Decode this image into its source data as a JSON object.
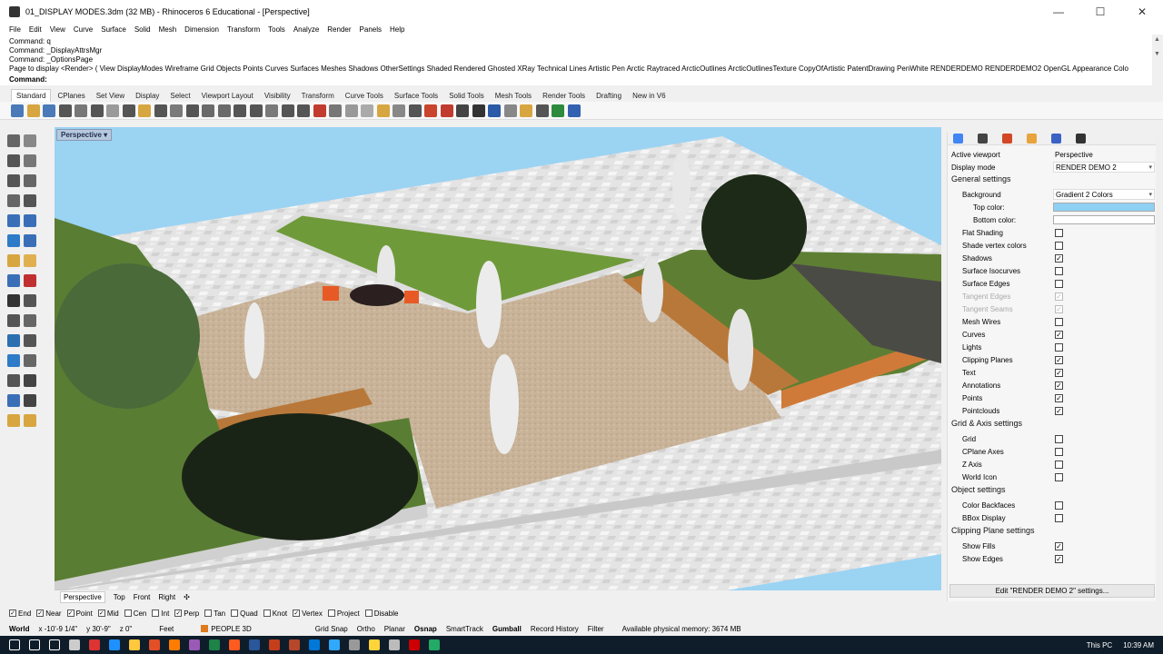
{
  "window": {
    "title": "01_DISPLAY MODES.3dm (32 MB) - Rhinoceros 6 Educational - [Perspective]",
    "minimize": "—",
    "maximize": "☐",
    "close": "✕"
  },
  "menu": [
    "File",
    "Edit",
    "View",
    "Curve",
    "Surface",
    "Solid",
    "Mesh",
    "Dimension",
    "Transform",
    "Tools",
    "Analyze",
    "Render",
    "Panels",
    "Help"
  ],
  "command_history": [
    "Command: q",
    "Command: _DisplayAttrsMgr",
    "Command: _OptionsPage",
    "Page to display <Render> ( View DisplayModes Wireframe Grid Objects Points Curves Surfaces Meshes Shadows OtherSettings Shaded Rendered Ghosted XRay Technical Lines Artistic Pen Arctic Raytraced ArcticOutlines ArcticOutlinesTexture CopyOfArtistic PatentDrawing PenWhite RENDERDEMO RENDERDEMO2 OpenGL Appearance Colo"
  ],
  "command_prompt": "Command:",
  "toolbar_tabs": [
    "Standard",
    "CPlanes",
    "Set View",
    "Display",
    "Select",
    "Viewport Layout",
    "Visibility",
    "Transform",
    "Curve Tools",
    "Surface Tools",
    "Solid Tools",
    "Mesh Tools",
    "Render Tools",
    "Drafting",
    "New in V6"
  ],
  "toolbar_colors": [
    "#4a7ab8",
    "#d8a640",
    "#4a7ab8",
    "#555",
    "#777",
    "#555",
    "#9a9a9a",
    "#555",
    "#d8a640",
    "#555",
    "#7a7a7a",
    "#555",
    "#6a6a6a",
    "#6a6a6a",
    "#555",
    "#555",
    "#7a7a7a",
    "#555",
    "#555",
    "#c23b2f",
    "#777",
    "#999",
    "#aaa",
    "#d8a640",
    "#888",
    "#555",
    "#c9452c",
    "#c23b2f",
    "#444",
    "#333",
    "#2b5aa7",
    "#888",
    "#d8a640",
    "#555",
    "#2e8a3c",
    "#3460b0"
  ],
  "viewport": {
    "label": "Perspective",
    "tabs": [
      "Perspective",
      "Top",
      "Front",
      "Right"
    ],
    "add_tab": "✣"
  },
  "osnap": [
    {
      "label": "End",
      "checked": true
    },
    {
      "label": "Near",
      "checked": true
    },
    {
      "label": "Point",
      "checked": true
    },
    {
      "label": "Mid",
      "checked": true
    },
    {
      "label": "Cen",
      "checked": false
    },
    {
      "label": "Int",
      "checked": false
    },
    {
      "label": "Perp",
      "checked": true
    },
    {
      "label": "Tan",
      "checked": false
    },
    {
      "label": "Quad",
      "checked": false
    },
    {
      "label": "Knot",
      "checked": false
    },
    {
      "label": "Vertex",
      "checked": true
    },
    {
      "label": "Project",
      "checked": false
    },
    {
      "label": "Disable",
      "checked": false
    }
  ],
  "status": {
    "cplane": "World",
    "x": "x -10'-9 1/4\"",
    "y": "y 30'-9\"",
    "z": "z 0\"",
    "units": "Feet",
    "layer": "PEOPLE 3D",
    "layer_color": "#e07a1e",
    "toggles": [
      "Grid Snap",
      "Ortho",
      "Planar",
      "Osnap",
      "SmartTrack",
      "Gumball",
      "Record History",
      "Filter"
    ],
    "memory": "Available physical memory: 3674 MB"
  },
  "taskbar": {
    "tray_label": "This PC",
    "time": "10:39 AM",
    "icon_colors": [
      "#ffffff",
      "#ffffff",
      "#ffffff",
      "#cccccc",
      "#d33",
      "#1e90ff",
      "#ffc83d",
      "#e34f26",
      "#ff7c00",
      "#9b59b6",
      "#1d8348",
      "#ff5a1f",
      "#2b579a",
      "#c43e1c",
      "#b7472a",
      "#0078d7",
      "#31a8ff",
      "#999",
      "#ffd43b",
      "#bbbbbb",
      "#c00",
      "#2a6"
    ]
  },
  "panel": {
    "tab_colors": [
      "#4285f4",
      "#444",
      "#d24726",
      "#e8a33b",
      "#3a62c4",
      "#333"
    ],
    "active_viewport_label": "Active viewport",
    "active_viewport_value": "Perspective",
    "display_mode_label": "Display mode",
    "display_mode_value": "RENDER DEMO 2",
    "general_header": "General settings",
    "background_label": "Background",
    "background_value": "Gradient 2 Colors",
    "top_color_label": "Top color:",
    "top_color": "#8fd0f5",
    "bottom_color_label": "Bottom color:",
    "bottom_color": "#ffffff",
    "general_items": [
      {
        "label": "Flat Shading",
        "checked": false,
        "disabled": false
      },
      {
        "label": "Shade vertex colors",
        "checked": false,
        "disabled": false
      },
      {
        "label": "Shadows",
        "checked": true,
        "disabled": false
      },
      {
        "label": "Surface Isocurves",
        "checked": false,
        "disabled": false
      },
      {
        "label": "Surface Edges",
        "checked": false,
        "disabled": false
      },
      {
        "label": "Tangent Edges",
        "checked": true,
        "disabled": true
      },
      {
        "label": "Tangent Seams",
        "checked": true,
        "disabled": true
      },
      {
        "label": "Mesh Wires",
        "checked": false,
        "disabled": false
      },
      {
        "label": "Curves",
        "checked": true,
        "disabled": false
      },
      {
        "label": "Lights",
        "checked": false,
        "disabled": false
      },
      {
        "label": "Clipping Planes",
        "checked": true,
        "disabled": false
      },
      {
        "label": "Text",
        "checked": true,
        "disabled": false
      },
      {
        "label": "Annotations",
        "checked": true,
        "disabled": false
      },
      {
        "label": "Points",
        "checked": true,
        "disabled": false
      },
      {
        "label": "Pointclouds",
        "checked": true,
        "disabled": false
      }
    ],
    "grid_header": "Grid & Axis settings",
    "grid_items": [
      {
        "label": "Grid",
        "checked": false
      },
      {
        "label": "CPlane Axes",
        "checked": false
      },
      {
        "label": "Z Axis",
        "checked": false
      },
      {
        "label": "World Icon",
        "checked": false
      }
    ],
    "object_header": "Object settings",
    "object_items": [
      {
        "label": "Color Backfaces",
        "checked": false
      },
      {
        "label": "BBox Display",
        "checked": false
      }
    ],
    "clip_header": "Clipping Plane settings",
    "clip_items": [
      {
        "label": "Show Fills",
        "checked": true
      },
      {
        "label": "Show Edges",
        "checked": true
      }
    ],
    "edit_button": "Edit \"RENDER DEMO 2\" settings..."
  }
}
